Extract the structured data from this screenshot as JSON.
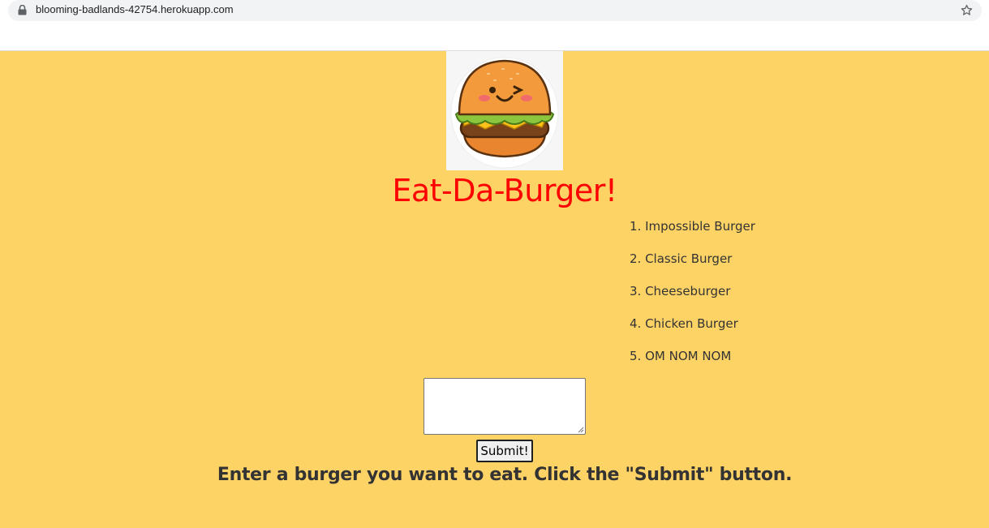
{
  "browser": {
    "url": "blooming-badlands-42754.herokuapp.com",
    "lock_icon": "lock-icon",
    "bookmark_icon": "star-icon"
  },
  "page": {
    "background_color": "#fed366",
    "logo_icon": "burger-mascot-logo",
    "title": "Eat-Da-Burger!",
    "title_color": "#ff0000",
    "burgers": [
      "1. Impossible Burger",
      "2. Classic Burger",
      "3. Cheeseburger",
      "4. Chicken Burger",
      "5. OM NOM NOM"
    ],
    "burger_input": {
      "value": "",
      "placeholder": ""
    },
    "submit_label": "Submit!",
    "instructions": "Enter a burger you want to eat. Click the \"Submit\" button."
  }
}
